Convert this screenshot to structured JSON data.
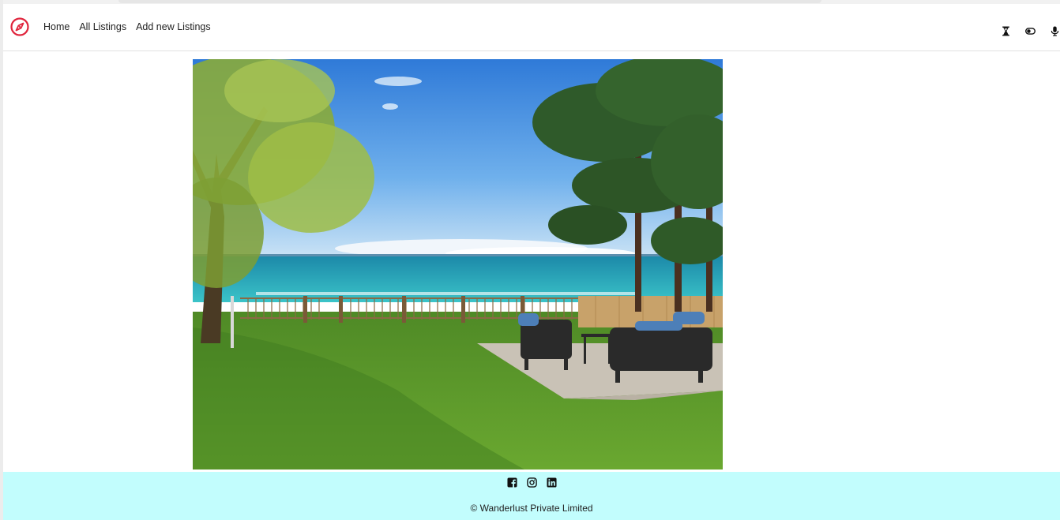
{
  "brand": {
    "icon": "compass-icon",
    "color": "#e0243c"
  },
  "nav": {
    "links": [
      {
        "label": "Home"
      },
      {
        "label": "All Listings"
      },
      {
        "label": "Add new Listings"
      }
    ],
    "right_icons": [
      "hourglass-icon",
      "toggle-icon",
      "microphone-icon"
    ]
  },
  "listing": {
    "image_alt": "Lakeside backyard with lawn, trees, fence and wicker patio chairs"
  },
  "footer": {
    "background": "#c2fdfd",
    "socials": [
      "facebook-icon",
      "instagram-icon",
      "linkedin-icon"
    ],
    "copyright": "© Wanderlust Private Limited"
  }
}
